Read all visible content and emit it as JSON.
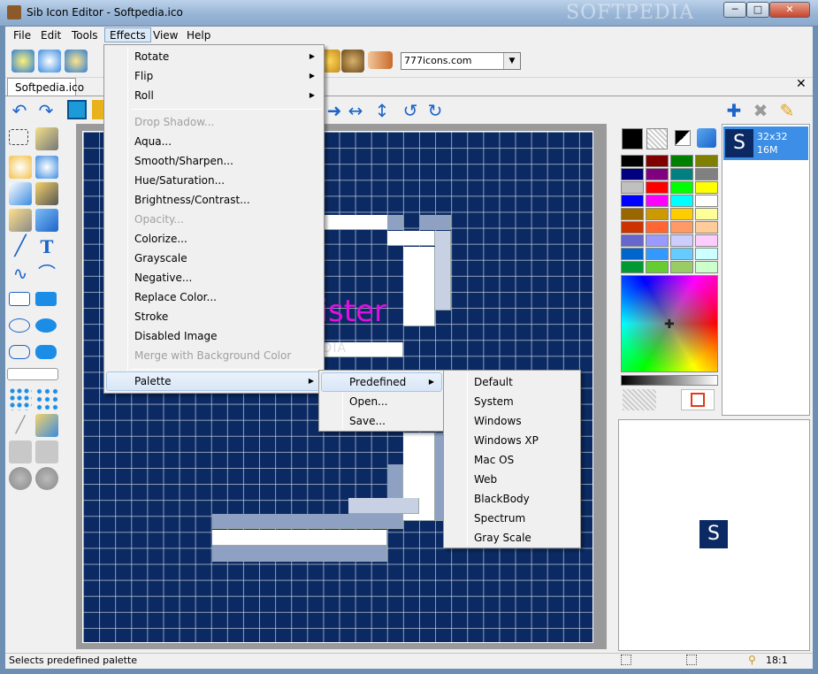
{
  "window": {
    "title": "Sib Icon Editor - Softpedia.ico",
    "watermark": "SOFTPEDIA"
  },
  "menubar": [
    "File",
    "Edit",
    "Tools",
    "Effects",
    "View",
    "Help"
  ],
  "toolbar": {
    "source_combo_value": "777icons.com"
  },
  "document_tab": "Softpedia.ico",
  "canvas": {
    "overlay_text": "gister",
    "watermark_text": "SOFTPEDIA"
  },
  "effects_menu": {
    "items": [
      {
        "label": "Rotate",
        "submenu": true,
        "disabled": false
      },
      {
        "label": "Flip",
        "submenu": true,
        "disabled": false
      },
      {
        "label": "Roll",
        "submenu": true,
        "disabled": false
      },
      {
        "label": "Drop Shadow...",
        "disabled": true
      },
      {
        "label": "Aqua...",
        "disabled": false
      },
      {
        "label": "Smooth/Sharpen...",
        "disabled": false
      },
      {
        "label": "Hue/Saturation...",
        "disabled": false
      },
      {
        "label": "Brightness/Contrast...",
        "disabled": false
      },
      {
        "label": "Opacity...",
        "disabled": true
      },
      {
        "label": "Colorize...",
        "disabled": false
      },
      {
        "label": "Grayscale",
        "disabled": false
      },
      {
        "label": "Negative...",
        "disabled": false
      },
      {
        "label": "Replace Color...",
        "disabled": false
      },
      {
        "label": "Stroke",
        "disabled": false
      },
      {
        "label": "Disabled Image",
        "disabled": false
      },
      {
        "label": "Merge with Background Color",
        "disabled": true
      },
      {
        "label": "Palette",
        "submenu": true,
        "highlighted": true
      }
    ]
  },
  "palette_menu": {
    "items": [
      {
        "label": "Predefined",
        "submenu": true,
        "highlighted": true
      },
      {
        "label": "Open..."
      },
      {
        "label": "Save..."
      }
    ]
  },
  "predefined_menu": {
    "items": [
      "Default",
      "System",
      "Windows",
      "Windows XP",
      "Mac OS",
      "Web",
      "BlackBody",
      "Spectrum",
      "Gray Scale"
    ]
  },
  "formats": {
    "size": "32x32",
    "depth": "16M",
    "icon_letter": "S"
  },
  "preview": {
    "icon_letter": "S"
  },
  "palette_colors": [
    [
      "#000000",
      "#800000",
      "#008000",
      "#808000"
    ],
    [
      "#000080",
      "#800080",
      "#008080",
      "#808080"
    ],
    [
      "#c0c0c0",
      "#ff0000",
      "#00ff00",
      "#ffff00"
    ],
    [
      "#0000ff",
      "#ff00ff",
      "#00ffff",
      "#ffffff"
    ],
    [
      "#996600",
      "#cc9900",
      "#ffcc00",
      "#ffff99"
    ],
    [
      "#cc3300",
      "#ff6633",
      "#ff9966",
      "#ffcc99"
    ],
    [
      "#6666cc",
      "#9999ff",
      "#ccccff",
      "#ffccff"
    ],
    [
      "#0066cc",
      "#3399ff",
      "#66ccff",
      "#ccffff"
    ],
    [
      "#009933",
      "#66cc33",
      "#99cc66",
      "#ccffcc"
    ]
  ],
  "status": {
    "text": "Selects predefined palette",
    "zoom": "18:1"
  }
}
